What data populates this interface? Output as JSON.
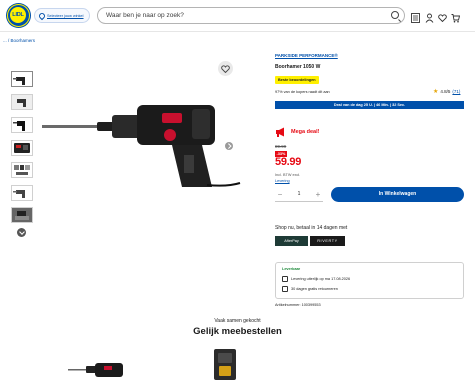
{
  "header": {
    "logo_text": "LIDL",
    "store_label": "Selecteer jouw winkel",
    "search_placeholder": "Waar ben je naar op zoek?"
  },
  "breadcrumb": {
    "parent": "...",
    "current": "Boorhamers"
  },
  "product": {
    "brand": "PARKSIDE PERFORMANCE®",
    "title": "Boorhamer 1050 W",
    "badge": "Beste beoordelingen",
    "recommend": "97% van de kopers raadt dit aan",
    "rating": "4.8/5",
    "rating_count": "(71)",
    "deal_bar": "Deal van de dag 25 U. | 46 Min. | 32 Sec.",
    "deal_label": "Mega deal!",
    "old_price": "89.99",
    "discount": "-33%",
    "price": "59.99",
    "vat": "Incl. BTW excl.",
    "delivery_link": "Levering",
    "quantity": "1",
    "cart_button": "In Winkelwagen"
  },
  "payment": {
    "label": "Shop nu, betaal in 14 dagen met",
    "option_1": "AfterPay",
    "option_2": "RIVERTY"
  },
  "delivery": {
    "status": "Leverbaar",
    "row_1": "Levering uiterlijk op ma 17.08.2026",
    "row_2": "30 dagen gratis retourneren",
    "article": "Artikelnummer: 100399553"
  },
  "recommendations": {
    "kicker": "Vaak samen gekocht",
    "heading": "Gelijk meebestellen"
  },
  "colors": {
    "accent": "#0050aa",
    "deal": "#e60a14",
    "badge": "#fff000"
  },
  "icons": [
    "location-pin-icon",
    "search-icon",
    "list-icon",
    "user-icon",
    "heart-icon",
    "cart-icon",
    "favorite-icon",
    "megaphone-icon",
    "chevron-down-icon",
    "chevron-right-icon"
  ]
}
